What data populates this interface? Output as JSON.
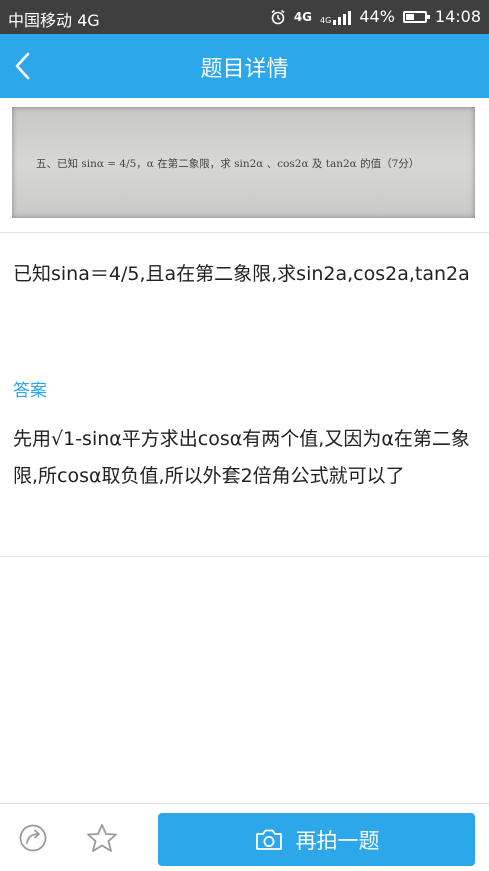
{
  "status_bar": {
    "carrier": "中国移动 4G",
    "network_1": "4G",
    "network_2": "4G",
    "battery_percent": "44%",
    "battery_level": 0.44,
    "time": "14:08"
  },
  "header": {
    "title": "题目详情",
    "back_icon": "chevron-left-icon",
    "background": "#2ba7ea"
  },
  "photo": {
    "text": "五、已知 sinα = 4/5，α 在第二象限，求 sin2α 、cos2α 及 tan2α 的值（7分）"
  },
  "question": {
    "text": "已知sina＝4/5,且a在第二象限,求sin2a,cos2a,tan2a"
  },
  "answer": {
    "label": "答案",
    "text": "先用√1-sinα平方求出cosα有两个值,又因为α在第二象限,所cosα取负值,所以外套2倍角公式就可以了"
  },
  "bottom_bar": {
    "share_icon": "share-icon",
    "favorite_icon": "star-icon",
    "retake_icon": "camera-icon",
    "retake_label": "再拍一题"
  }
}
